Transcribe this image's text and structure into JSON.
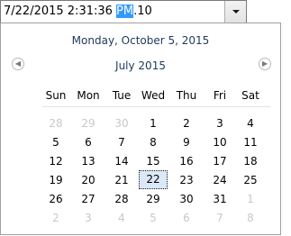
{
  "picker": {
    "value_pre": "7/22/2015 2:31:36 ",
    "value_sel": "PM",
    "value_post": ".10"
  },
  "calendar": {
    "today_text": "Monday, October 5, 2015",
    "month_title": "July 2015",
    "days_of_week": [
      "Sun",
      "Mon",
      "Tue",
      "Wed",
      "Thu",
      "Fri",
      "Sat"
    ],
    "weeks": [
      [
        {
          "d": "28",
          "m": true
        },
        {
          "d": "29",
          "m": true
        },
        {
          "d": "30",
          "m": true
        },
        {
          "d": "1"
        },
        {
          "d": "2"
        },
        {
          "d": "3"
        },
        {
          "d": "4"
        }
      ],
      [
        {
          "d": "5"
        },
        {
          "d": "6"
        },
        {
          "d": "7"
        },
        {
          "d": "8"
        },
        {
          "d": "9"
        },
        {
          "d": "10"
        },
        {
          "d": "11"
        }
      ],
      [
        {
          "d": "12"
        },
        {
          "d": "13"
        },
        {
          "d": "14"
        },
        {
          "d": "15"
        },
        {
          "d": "16"
        },
        {
          "d": "17"
        },
        {
          "d": "18"
        }
      ],
      [
        {
          "d": "19"
        },
        {
          "d": "20"
        },
        {
          "d": "21"
        },
        {
          "d": "22",
          "sel": true
        },
        {
          "d": "23"
        },
        {
          "d": "24"
        },
        {
          "d": "25"
        }
      ],
      [
        {
          "d": "26"
        },
        {
          "d": "27"
        },
        {
          "d": "28"
        },
        {
          "d": "29"
        },
        {
          "d": "30"
        },
        {
          "d": "31"
        },
        {
          "d": "1",
          "m": true
        }
      ],
      [
        {
          "d": "2",
          "m": true
        },
        {
          "d": "3",
          "m": true
        },
        {
          "d": "4",
          "m": true
        },
        {
          "d": "5",
          "m": true
        },
        {
          "d": "6",
          "m": true
        },
        {
          "d": "7",
          "m": true
        },
        {
          "d": "8",
          "m": true
        }
      ]
    ]
  },
  "colors": {
    "selection": "#3399ff",
    "header_text": "#1e395b",
    "muted_day": "#c8c8c8",
    "selected_day_bg": "#dbe8f7"
  },
  "icons": {
    "dropdown": "chevron-down-icon",
    "prev": "prev-month-icon",
    "next": "next-month-icon"
  }
}
